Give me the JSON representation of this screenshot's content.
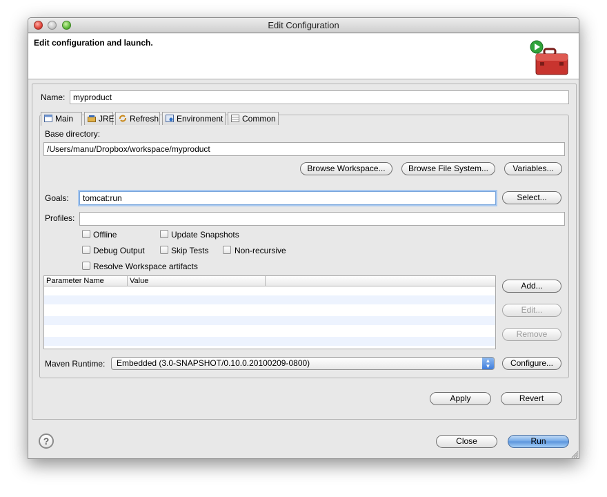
{
  "window": {
    "title": "Edit Configuration"
  },
  "header": {
    "title": "Edit configuration and launch."
  },
  "form": {
    "name_label": "Name:",
    "name_value": "myproduct",
    "base_dir_label": "Base directory:",
    "base_dir_value": "/Users/manu/Dropbox/workspace/myproduct",
    "goals_label": "Goals:",
    "goals_value": "tomcat:run",
    "profiles_label": "Profiles:",
    "profiles_value": "",
    "maven_runtime_label": "Maven Runtime:",
    "maven_runtime_value": "Embedded (3.0-SNAPSHOT/0.10.0.20100209-0800)"
  },
  "tabs": [
    {
      "label": "Main",
      "icon": "main-tab-icon",
      "active": true
    },
    {
      "label": "JRE",
      "icon": "jre-icon"
    },
    {
      "label": "Refresh",
      "icon": "refresh-icon"
    },
    {
      "label": "Environment",
      "icon": "environment-icon"
    },
    {
      "label": "Common",
      "icon": "common-icon"
    }
  ],
  "buttons": {
    "browse_workspace": "Browse Workspace...",
    "browse_file_system": "Browse File System...",
    "variables": "Variables...",
    "select": "Select...",
    "add": "Add...",
    "edit": "Edit...",
    "remove": "Remove",
    "configure": "Configure...",
    "apply": "Apply",
    "revert": "Revert",
    "close": "Close",
    "run": "Run"
  },
  "options": {
    "offline": "Offline",
    "update_snapshots": "Update Snapshots",
    "debug_output": "Debug Output",
    "skip_tests": "Skip Tests",
    "non_recursive": "Non-recursive",
    "resolve_workspace": "Resolve Workspace artifacts"
  },
  "params_table": {
    "columns": [
      "Parameter Name",
      "Value"
    ],
    "rows": []
  },
  "help": {
    "glyph": "?"
  },
  "colors": {
    "accent": "#5a94dc",
    "toolbox_red": "#c8342e",
    "play_green": "#2fa33a"
  }
}
